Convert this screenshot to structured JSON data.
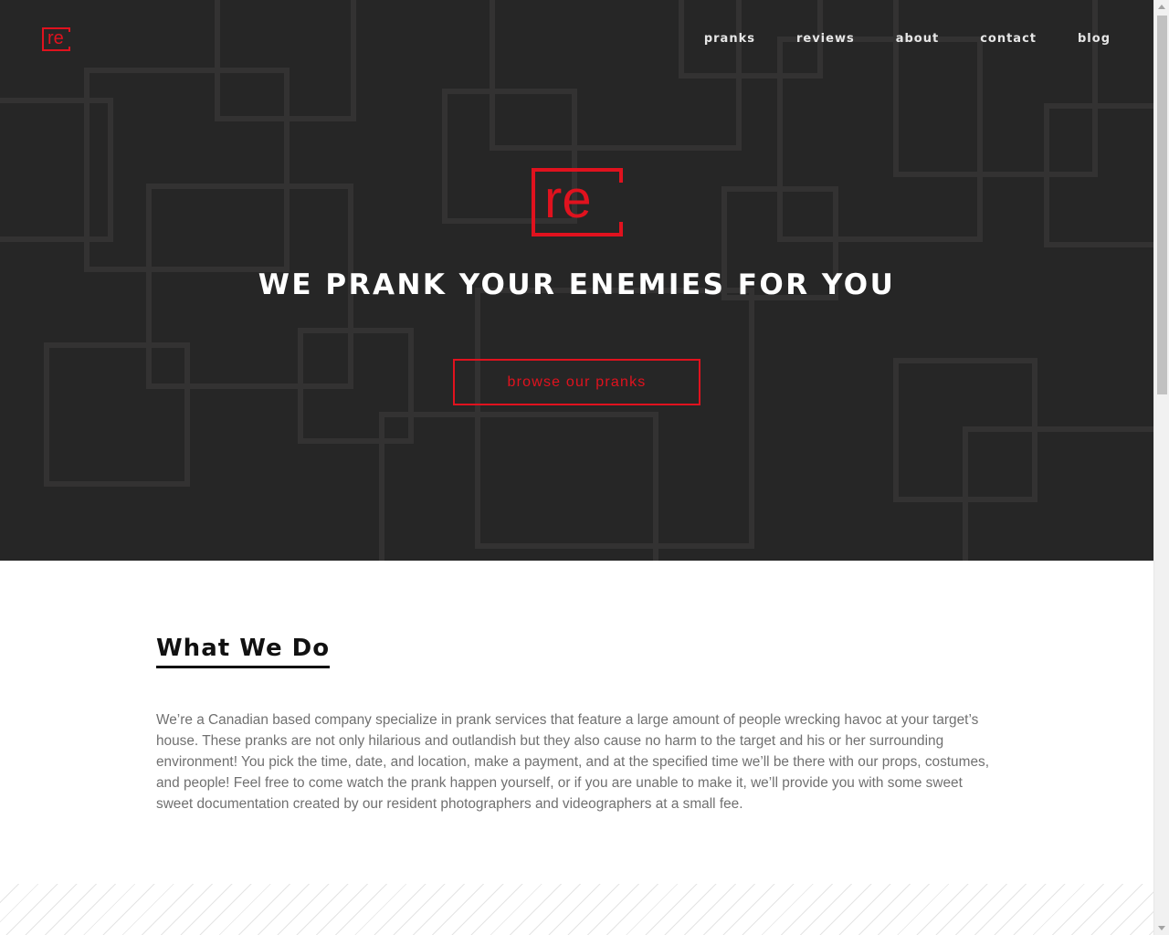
{
  "header": {
    "logo_text": "re",
    "nav": [
      {
        "label": "pranks"
      },
      {
        "label": "reviews"
      },
      {
        "label": "about"
      },
      {
        "label": "contact"
      },
      {
        "label": "blog"
      }
    ]
  },
  "hero": {
    "logo_text": "re",
    "headline": "WE PRANK YOUR ENEMIES FOR YOU",
    "cta_label": "browse our pranks"
  },
  "what_we_do": {
    "title": "What We Do",
    "body": "We’re a Canadian based company specialize in prank services that feature a large amount of people wrecking havoc at your target’s house. These pranks are not only hilarious and outlandish but they also cause no harm to the target and his or her surrounding environment! You pick the time, date, and location, make a payment, and at the specified time we’ll be there with our props, costumes, and people! Feel free to come watch the prank happen yourself, or if you are unable to make it, we’ll provide you with some sweet sweet documentation created by our resident photographers and videographers at a small fee."
  },
  "colors": {
    "accent": "#e0121e",
    "hero_background": "#262626",
    "body_text": "#707070"
  }
}
